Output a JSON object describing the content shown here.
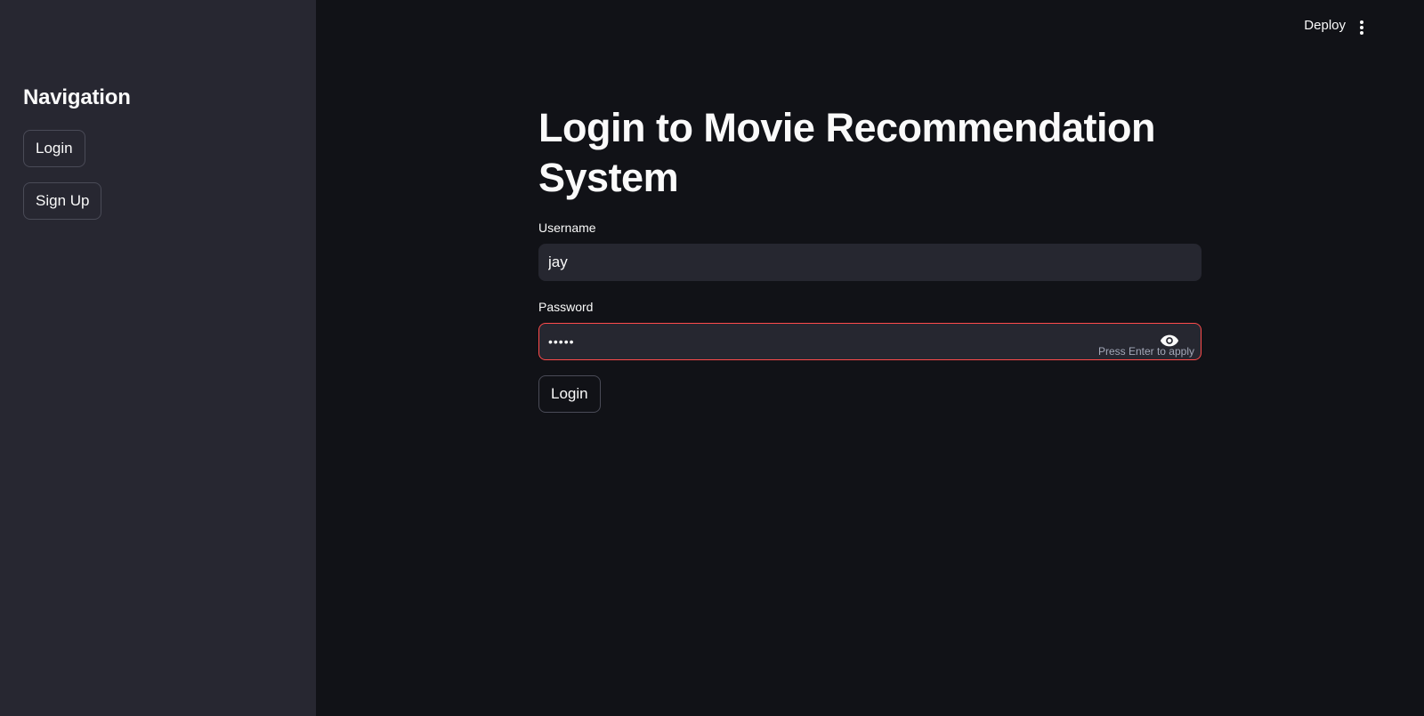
{
  "header": {
    "deploy_label": "Deploy",
    "menu_icon": "vertical-ellipsis-icon"
  },
  "sidebar": {
    "title": "Navigation",
    "items": [
      {
        "label": "Login"
      },
      {
        "label": "Sign Up"
      }
    ]
  },
  "main": {
    "title": "Login to Movie Recommendation System",
    "username": {
      "label": "Username",
      "value": "jay"
    },
    "password": {
      "label": "Password",
      "value": "•••••",
      "hint": "Press Enter to apply",
      "toggle_icon": "eye-icon"
    },
    "login_button": "Login"
  },
  "colors": {
    "sidebar_bg": "#272731",
    "main_bg": "#111217",
    "input_bg": "#262730",
    "error_border": "#ff4b4b",
    "text": "#fafafa"
  }
}
